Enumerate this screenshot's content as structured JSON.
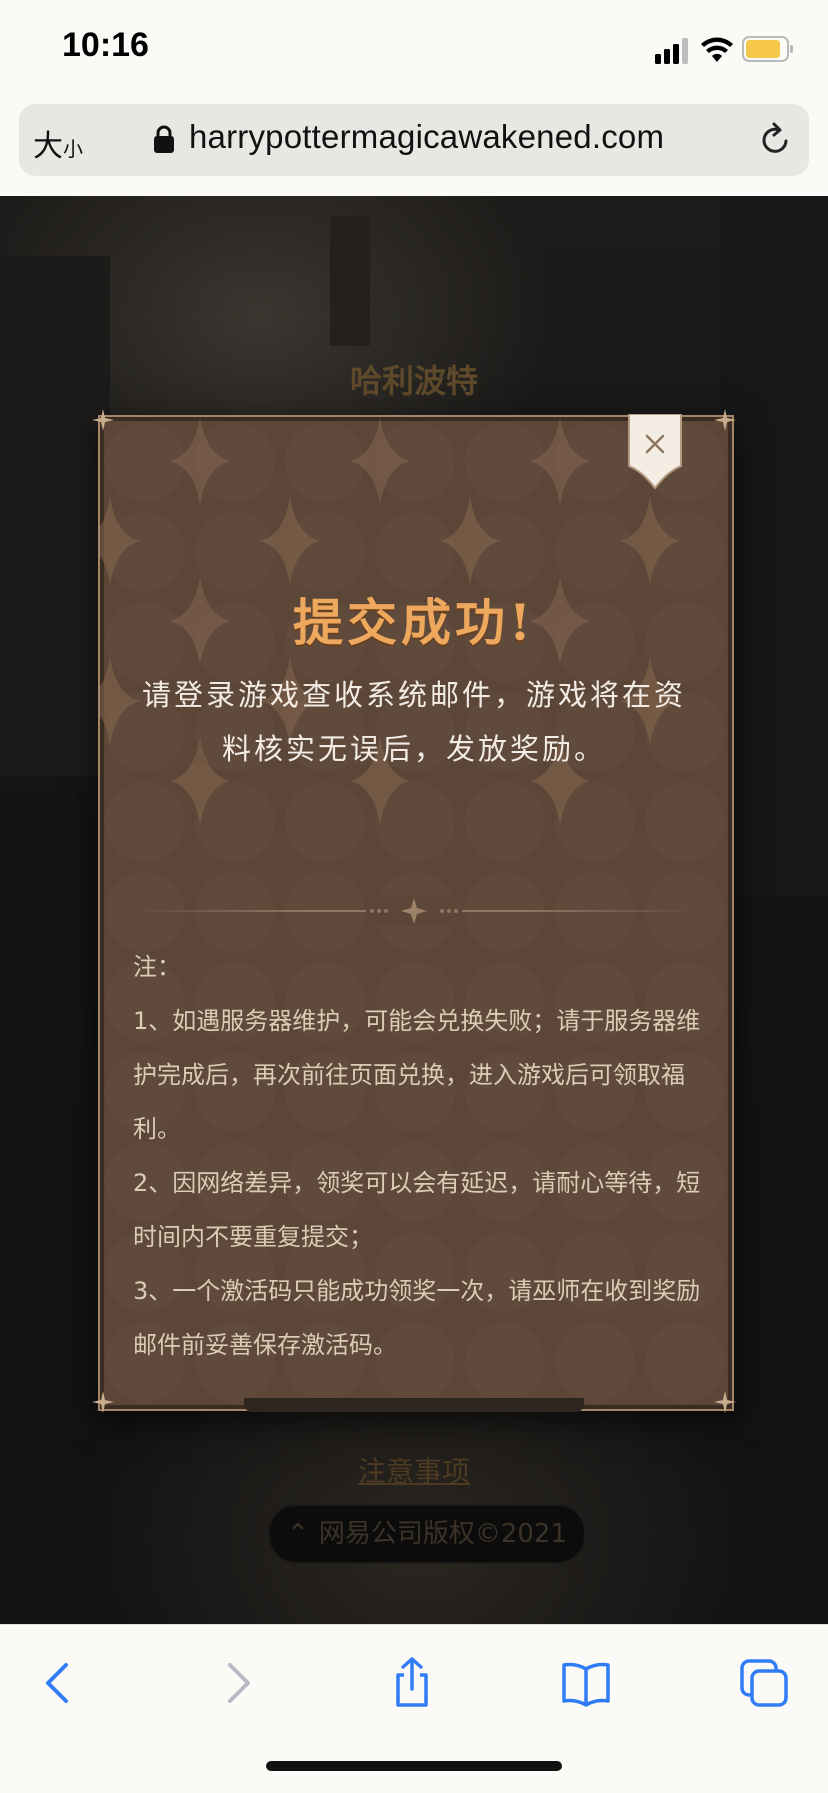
{
  "status_bar": {
    "time": "10:16",
    "battery_color": "#f5c84a"
  },
  "address_bar": {
    "text_size_large": "大",
    "text_size_small": "小",
    "url": "harrypottermagicawakened.com"
  },
  "background_page": {
    "title": "哈利波特",
    "notice_link": "注意事项",
    "copyright": "网易公司版权©2021"
  },
  "modal": {
    "title": "提交成功!",
    "message": "请登录游戏查收系统邮件，游戏将在资料核实无误后，发放奖励。",
    "notes_heading": "注：",
    "notes": [
      "1、如遇服务器维护，可能会兑换失败；请于服务器维护完成后，再次前往页面兑换，进入游戏后可领取福利。",
      "2、因网络差异，领奖可以会有延迟，请耐心等待，短时间内不要重复提交；",
      "3、一个激活码只能成功领奖一次，请巫师在收到奖励邮件前妥善保存激活码。"
    ],
    "colors": {
      "panel": "#5b4638",
      "title": "#eea85e",
      "border": "#a48568"
    }
  },
  "toolbar": {
    "icons": [
      "back-icon",
      "forward-icon",
      "share-icon",
      "bookmarks-icon",
      "tabs-icon"
    ],
    "accent_color": "#2f7cf6",
    "disabled_color": "#b7bcc4"
  }
}
